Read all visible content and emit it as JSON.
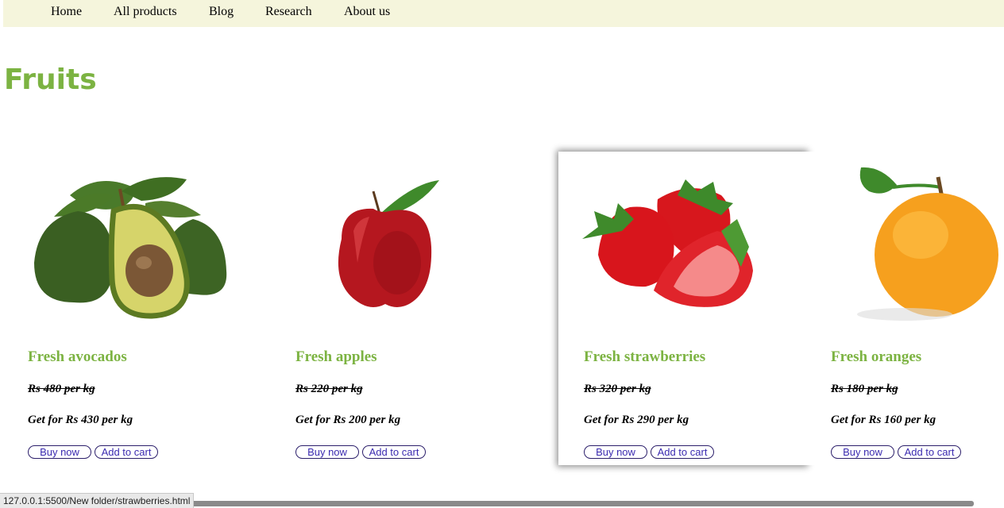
{
  "nav": {
    "items": [
      "Home",
      "All products",
      "Blog",
      "Research",
      "About us"
    ]
  },
  "page": {
    "title": "Fruits"
  },
  "products": [
    {
      "name": "Fresh avocados",
      "old_price": "Rs 480 per kg",
      "new_price": "Get for Rs 430 per kg",
      "buy_label": "Buy now",
      "cart_label": "Add to cart",
      "image": "avocado-image"
    },
    {
      "name": "Fresh apples",
      "old_price": "Rs 220 per kg",
      "new_price": "Get for Rs 200 per kg",
      "buy_label": "Buy now",
      "cart_label": "Add to cart",
      "image": "apple-image"
    },
    {
      "name": "Fresh strawberries",
      "old_price": "Rs 320 per kg",
      "new_price": "Get for Rs 290 per kg",
      "buy_label": "Buy now",
      "cart_label": "Add to cart",
      "image": "strawberries-image"
    },
    {
      "name": "Fresh oranges",
      "old_price": "Rs 180 per kg",
      "new_price": "Get for Rs 160 per kg",
      "buy_label": "Buy now",
      "cart_label": "Add to cart",
      "image": "orange-image"
    }
  ],
  "status_bar": {
    "url": "127.0.0.1:5500/New folder/strawberries.html"
  },
  "colors": {
    "accent": "#7cb342",
    "nav_bg": "#f5f5dc",
    "button_text": "#3b2bb0"
  }
}
